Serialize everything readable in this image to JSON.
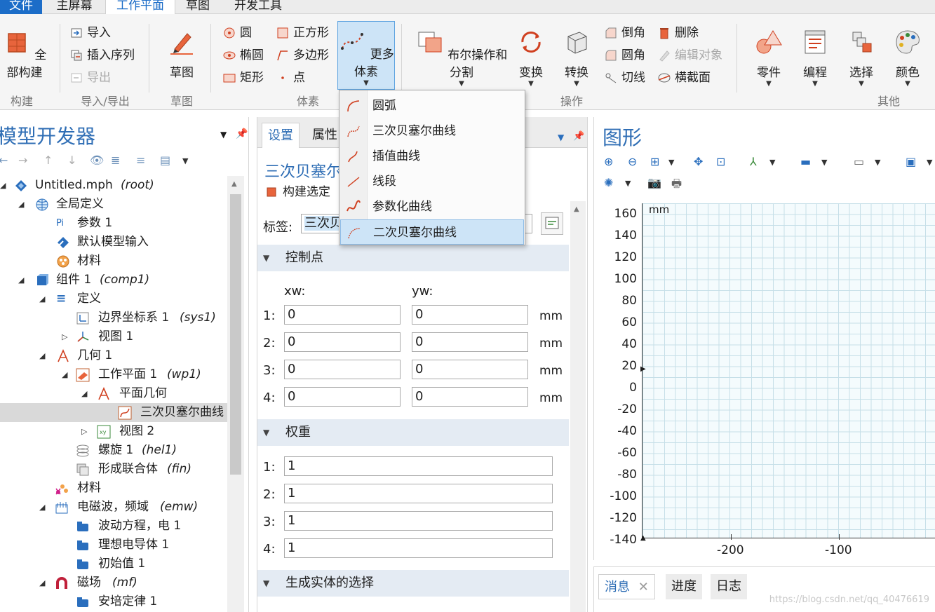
{
  "menubar": {
    "tabs": [
      "文件",
      "主屏幕",
      "工作平面",
      "草图",
      "开发工具"
    ],
    "active": "工作平面"
  },
  "ribbon": {
    "build_all": "全部构建",
    "import": "导入",
    "insert_sequence": "插入序列",
    "export": "导出",
    "sketch": "草图",
    "circle": "圆",
    "ellipse": "椭圆",
    "rectangle": "矩形",
    "square": "正方形",
    "polygon": "多边形",
    "point": "点",
    "more_primitives": "更多体素",
    "boolean_partition": "布尔操作和分割",
    "transform": "变换",
    "convert": "转换",
    "chamfer": "倒角",
    "fillet": "圆角",
    "tangent": "切线",
    "delete": "删除",
    "edit_object": "编辑对象",
    "cross_section": "横截面",
    "parts": "零件",
    "programming": "编程",
    "selection": "选择",
    "color": "颜色",
    "groups": {
      "build": "构建",
      "import_export": "导入/导出",
      "sketch": "草图",
      "primitives": "体素",
      "operations": "操作",
      "other": "其他"
    }
  },
  "dropdown": {
    "items": [
      "圆弧",
      "三次贝塞尔曲线",
      "插值曲线",
      "线段",
      "参数化曲线",
      "二次贝塞尔曲线"
    ],
    "selected_index": 5
  },
  "model_builder": {
    "title": "模型开发器",
    "tree": [
      {
        "label": "Untitled.mph",
        "tag": "(root)"
      },
      {
        "label": "全局定义",
        "tag": ""
      },
      {
        "label": "参数 1",
        "tag": ""
      },
      {
        "label": "默认模型输入",
        "tag": ""
      },
      {
        "label": "材料",
        "tag": ""
      },
      {
        "label": "组件 1",
        "tag": "(comp1)"
      },
      {
        "label": "定义",
        "tag": ""
      },
      {
        "label": "边界坐标系 1",
        "tag": "(sys1)"
      },
      {
        "label": "视图 1",
        "tag": ""
      },
      {
        "label": "几何 1",
        "tag": ""
      },
      {
        "label": "工作平面 1",
        "tag": "(wp1)"
      },
      {
        "label": "平面几何",
        "tag": ""
      },
      {
        "label": "三次贝塞尔曲线",
        "tag": ""
      },
      {
        "label": "视图 2",
        "tag": ""
      },
      {
        "label": "螺旋 1",
        "tag": "(hel1)"
      },
      {
        "label": "形成联合体",
        "tag": "(fin)"
      },
      {
        "label": "材料",
        "tag": ""
      },
      {
        "label": "电磁波，频域",
        "tag": "(emw)"
      },
      {
        "label": "波动方程，电 1",
        "tag": ""
      },
      {
        "label": "理想电导体 1",
        "tag": ""
      },
      {
        "label": "初始值 1",
        "tag": ""
      },
      {
        "label": "磁场",
        "tag": "(mf)"
      },
      {
        "label": "安培定律 1",
        "tag": ""
      }
    ]
  },
  "settings": {
    "tabs": [
      "设置",
      "属性"
    ],
    "node_title": "三次贝塞尔",
    "build_selected": "构建选定",
    "label_caption": "标签:",
    "label_value": "三次贝",
    "control_points": {
      "header": "控制点",
      "col_x": "xw:",
      "col_y": "yw:",
      "unit": "mm",
      "rows": [
        {
          "idx": "1:",
          "x": "0",
          "y": "0"
        },
        {
          "idx": "2:",
          "x": "0",
          "y": "0"
        },
        {
          "idx": "3:",
          "x": "0",
          "y": "0"
        },
        {
          "idx": "4:",
          "x": "0",
          "y": "0"
        }
      ]
    },
    "weights": {
      "header": "权重",
      "rows": [
        {
          "idx": "1:",
          "value": "1"
        },
        {
          "idx": "2:",
          "value": "1"
        },
        {
          "idx": "3:",
          "value": "1"
        },
        {
          "idx": "4:",
          "value": "1"
        }
      ]
    },
    "selection_header": "生成实体的选择"
  },
  "graphics": {
    "title": "图形",
    "unit_label": "mm",
    "y_ticks": [
      "160",
      "140",
      "120",
      "100",
      "80",
      "60",
      "40",
      "20",
      "0",
      "-20",
      "-40",
      "-60",
      "-80",
      "-100",
      "-120",
      "-140"
    ],
    "x_ticks": [
      "-200",
      "-100"
    ]
  },
  "messages": {
    "tabs": [
      "消息",
      "进度",
      "日志"
    ]
  },
  "watermark": "https://blog.csdn.net/qq_40476619"
}
